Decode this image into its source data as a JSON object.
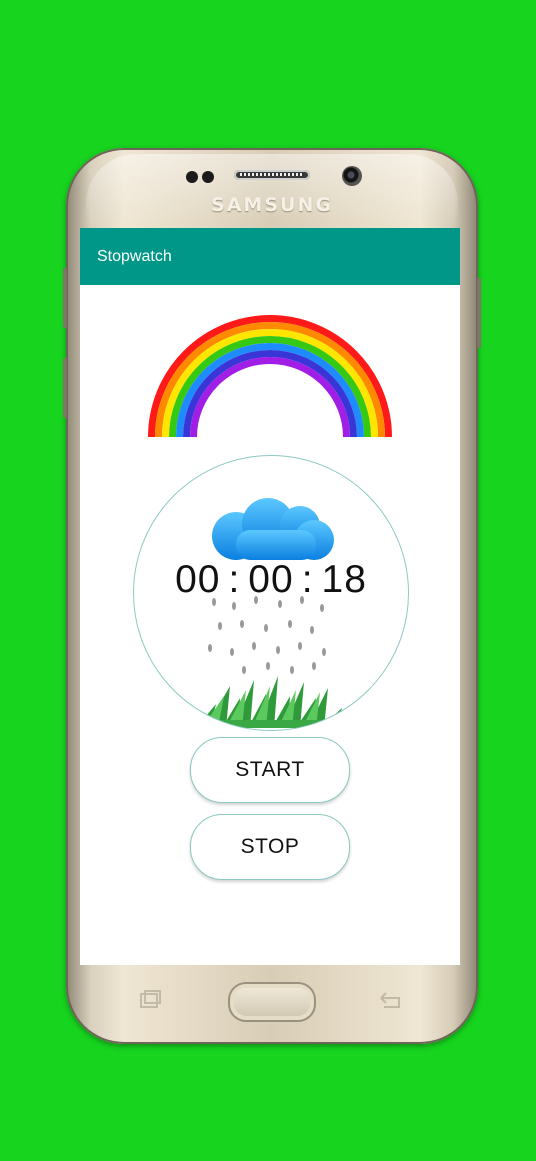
{
  "device": {
    "brand": "SAMSUNG"
  },
  "app": {
    "title": "Stopwatch",
    "accent_color": "#009688",
    "background_color": "#17d41f"
  },
  "timer": {
    "hours": "00",
    "minutes": "00",
    "seconds": "18",
    "separator": ":"
  },
  "buttons": {
    "start_label": "START",
    "stop_label": "STOP"
  },
  "icons": {
    "rainbow": "rainbow-image",
    "cloud": "cloud-icon",
    "rain": "rain-drops",
    "grass": "grass-image",
    "home": "home-key",
    "recents": "recents-key",
    "back": "back-key"
  }
}
